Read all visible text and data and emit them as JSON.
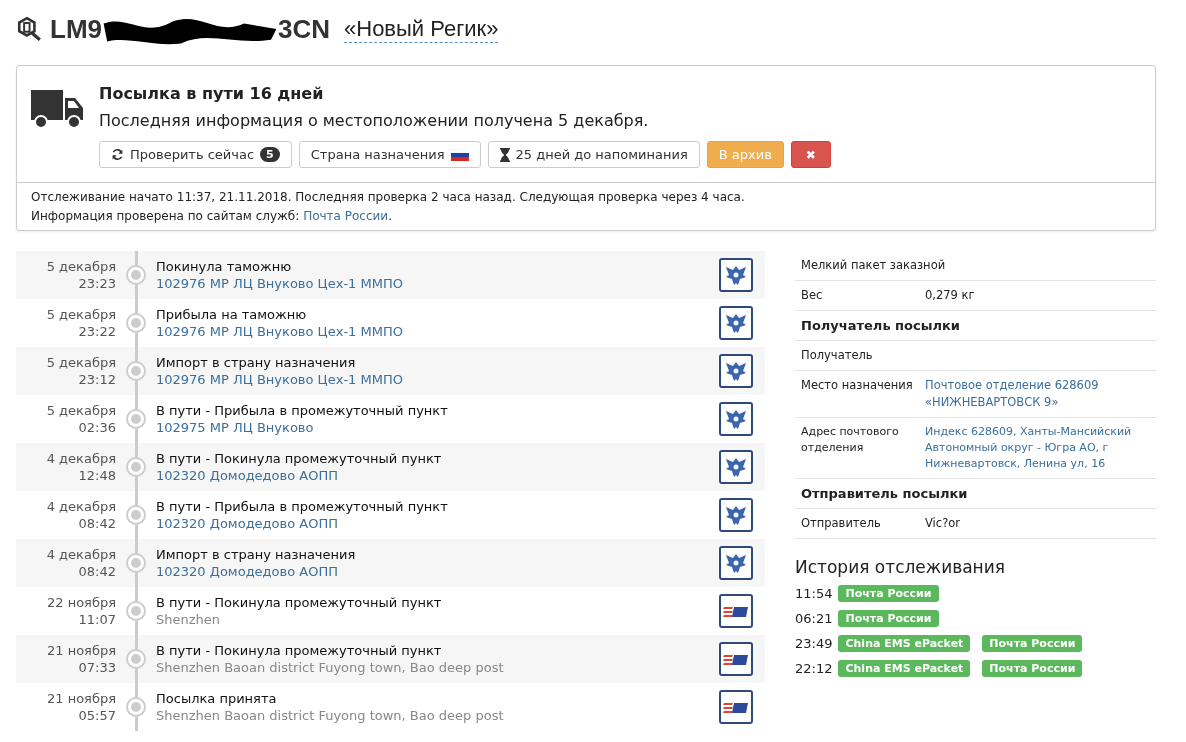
{
  "title": {
    "number_start": "LM9",
    "number_end": "3CN",
    "name": "«Новый Регик»"
  },
  "status": {
    "heading": "Посылка в пути 16 дней",
    "subheading": "Последняя информация о местоположении получена 5 декабря.",
    "buttons": [
      {
        "kind": "refresh",
        "label": "Проверить сейчас",
        "badge": "5"
      },
      {
        "kind": "country",
        "label": "Страна назначения"
      },
      {
        "kind": "reminder",
        "label": "25 дней до напоминания"
      },
      {
        "kind": "archive",
        "label": "В архив"
      },
      {
        "kind": "delete",
        "label": "✖"
      }
    ],
    "footer_line": "Отслеживание начато 11:37, 21.11.2018. Последняя проверка 2 часа назад. Следующая проверка через 4 часа.",
    "footer_prefix": "Информация проверена по сайтам служб:",
    "footer_link": "Почта России",
    "footer_suffix": "."
  },
  "events": [
    {
      "date": "5 декабря",
      "time": "23:23",
      "title": "Покинула таможню",
      "location": "102976 МР ЛЦ Внуково Цех-1 ММПО",
      "kind": "russian-post"
    },
    {
      "date": "5 декабря",
      "time": "23:22",
      "title": "Прибыла на таможню",
      "location": "102976 МР ЛЦ Внуково Цех-1 ММПО",
      "kind": "russian-post"
    },
    {
      "date": "5 декабря",
      "time": "23:12",
      "title": "Импорт в страну назначения",
      "location": "102976 МР ЛЦ Внуково Цех-1 ММПО",
      "kind": "russian-post"
    },
    {
      "date": "5 декабря",
      "time": "02:36",
      "title": "В пути - Прибыла в промежуточный пункт",
      "location": "102975 МР ЛЦ Внуково",
      "kind": "russian-post"
    },
    {
      "date": "4 декабря",
      "time": "12:48",
      "title": "В пути - Покинула промежуточный пункт",
      "location": "102320 Домодедово АОПП",
      "kind": "russian-post"
    },
    {
      "date": "4 декабря",
      "time": "08:42",
      "title": "В пути - Прибыла в промежуточный пункт",
      "location": "102320 Домодедово АОПП",
      "kind": "russian-post"
    },
    {
      "date": "4 декабря",
      "time": "08:42",
      "title": "Импорт в страну назначения",
      "location": "102320 Домодедово АОПП",
      "kind": "russian-post"
    },
    {
      "date": "22 ноября",
      "time": "11:07",
      "title": "В пути - Покинула промежуточный пункт",
      "location": "Shenzhen",
      "kind": "ems"
    },
    {
      "date": "21 ноября",
      "time": "07:33",
      "title": "В пути - Покинула промежуточный пункт",
      "location": "Shenzhen Baoan district Fuyong town, Bao deep post",
      "kind": "ems"
    },
    {
      "date": "21 ноября",
      "time": "05:57",
      "title": "Посылка принята",
      "location": "Shenzhen Baoan district Fuyong town, Bao deep post",
      "kind": "ems"
    }
  ],
  "details": [
    {
      "kind": "note",
      "label": "Мелкий пакет заказной"
    },
    {
      "kind": "pair",
      "label": "Вес",
      "value": "0,279 кг"
    },
    {
      "kind": "heading",
      "label": "Получатель посылки"
    },
    {
      "kind": "pair",
      "label": "Получатель"
    },
    {
      "kind": "link",
      "label": "Место назначения",
      "value": "Почтовое отделение 628609 «НИЖНЕВАРТОВСК 9»"
    },
    {
      "kind": "small-link",
      "label": "Адрес почтового отделения",
      "value": "Индекс 628609, Ханты-Мансийский Автономный округ - Югра АО, г Нижневартовск, Ленина ул, 16"
    },
    {
      "kind": "heading",
      "label": "Отправитель посылки"
    },
    {
      "kind": "pair",
      "label": "Отправитель",
      "value": "Vic?or"
    }
  ],
  "history": {
    "title": "История отслеживания",
    "rows": [
      {
        "time": "11:54",
        "services": [
          "Почта России"
        ]
      },
      {
        "time": "06:21",
        "services": [
          "Почта России"
        ]
      },
      {
        "time": "23:49",
        "services": [
          "China EMS ePacket",
          "Почта России"
        ]
      },
      {
        "time": "22:12",
        "services": [
          "China EMS ePacket",
          "Почта России"
        ]
      }
    ]
  }
}
